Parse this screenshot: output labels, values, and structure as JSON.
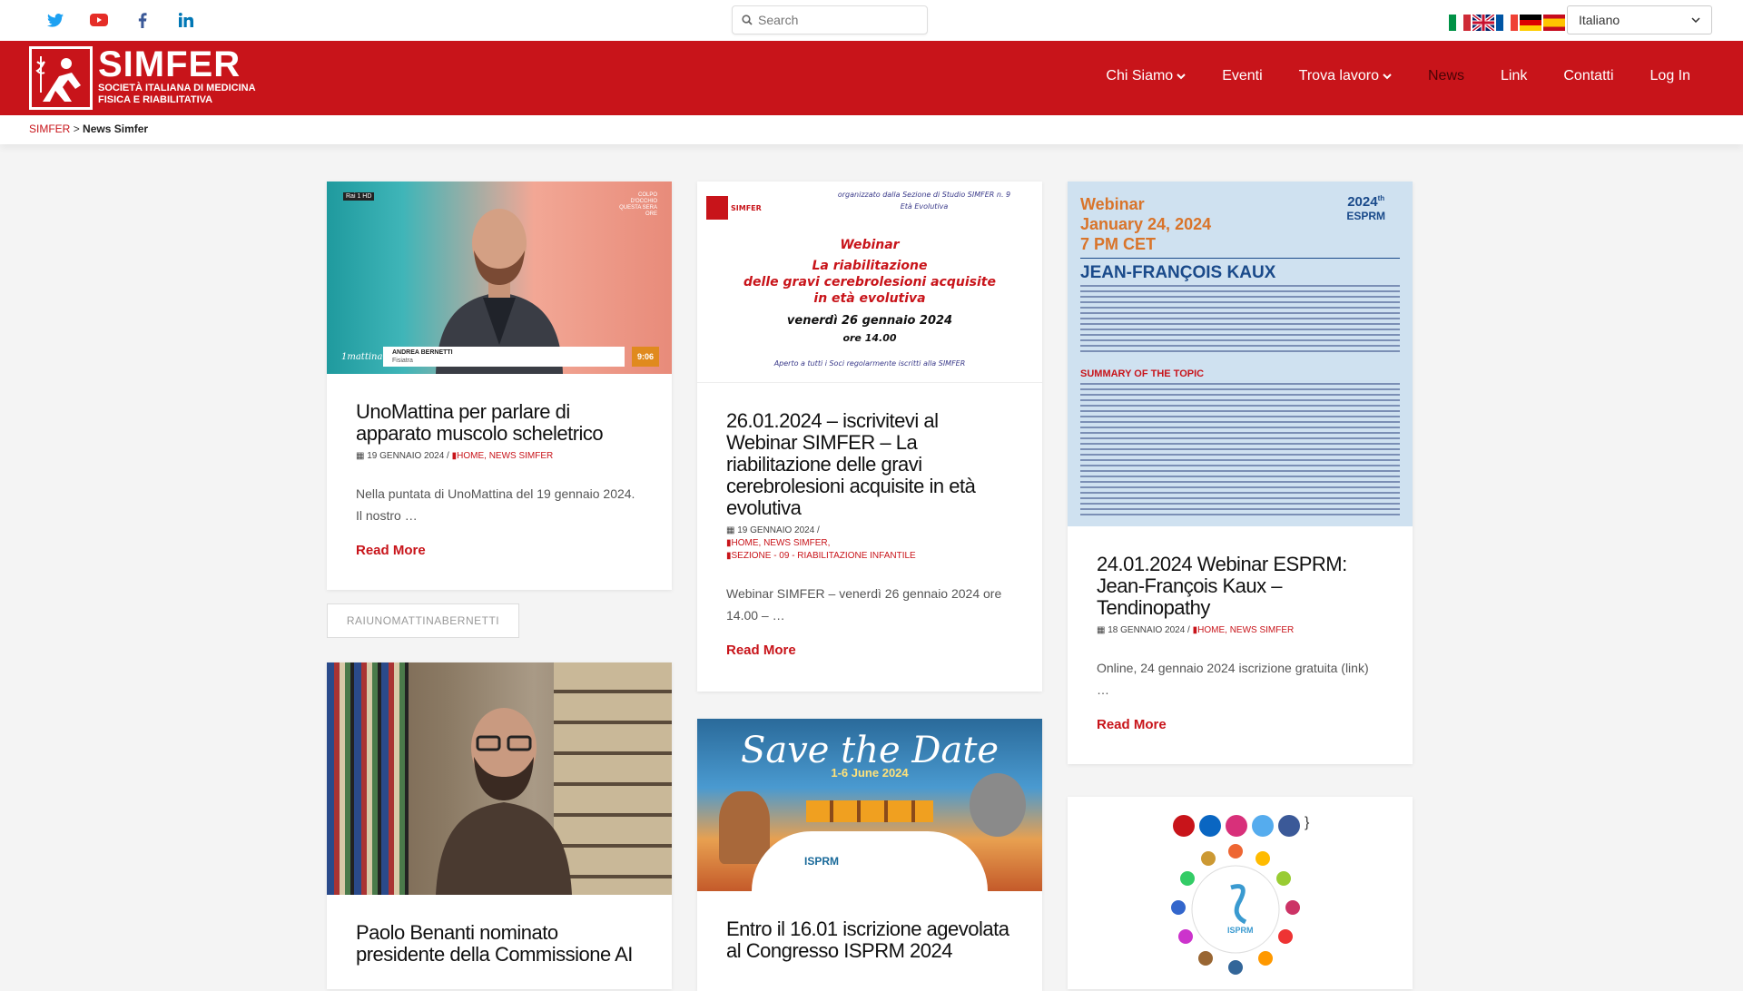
{
  "topbar": {
    "social": [
      {
        "name": "twitter-icon",
        "color": "#1da1f2"
      },
      {
        "name": "youtube-icon",
        "color": "#e52d27"
      },
      {
        "name": "facebook-icon",
        "color": "#3b5998"
      },
      {
        "name": "linkedin-icon",
        "color": "#0077b5"
      }
    ],
    "search_placeholder": "Search",
    "flags": [
      "italian-flag-icon",
      "uk-flag-icon",
      "french-flag-icon",
      "german-flag-icon",
      "spanish-flag-icon"
    ],
    "language": "Italiano"
  },
  "header": {
    "logo_title": "SIMFER",
    "logo_subtitle_1": "SOCIETÀ ITALIANA DI MEDICINA",
    "logo_subtitle_2": "FISICA E RIABILITATIVA",
    "brand_color": "#c8141a",
    "nav": [
      {
        "label": "Chi Siamo",
        "dropdown": true
      },
      {
        "label": "Eventi",
        "dropdown": false
      },
      {
        "label": "Trova lavoro",
        "dropdown": true
      },
      {
        "label": "News",
        "dropdown": false,
        "active": true
      },
      {
        "label": "Link",
        "dropdown": false
      },
      {
        "label": "Contatti",
        "dropdown": false
      },
      {
        "label": "Log In",
        "dropdown": false
      }
    ]
  },
  "breadcrumb": {
    "home": "SIMFER",
    "separator": ">",
    "current": "News Simfer"
  },
  "posts": [
    {
      "title": "UnoMattina per parlare di apparato muscolo scheletrico",
      "date": "19 GENNAIO 2024",
      "categories": "HOME, NEWS SIMFER",
      "excerpt": "Nella puntata di UnoMattina del 19 gennaio 2024. Il nostro …",
      "read_more": "Read More",
      "image": {
        "name_lower": "ANDREA BERNETTI",
        "role": "Fisiatra",
        "time": "9:06",
        "brand": "1mattina",
        "channel": "Rai 1 HD",
        "corner": "COLPO D'OCCHIO QUESTA SERA ORE"
      }
    },
    {
      "title": "26.01.2024 – iscrivitevi al Webinar SIMFER – La riabilitazione delle gravi cerebrolesioni acquisite in età evolutiva",
      "date": "19 GENNAIO 2024",
      "categories_1": "HOME, NEWS SIMFER,",
      "categories_2": "SEZIONE - 09 - RIABILITAZIONE INFANTILE",
      "excerpt": "Webinar SIMFER – venerdì 26 gennaio 2024 ore 14.00 – …",
      "read_more": "Read More",
      "image": {
        "org_1": "organizzato dalla Sezione di Studio SIMFER n. 9",
        "org_2": "Età Evolutiva",
        "logo": "SIMFER",
        "webinar": "Webinar",
        "t1": "La riabilitazione",
        "t2": "delle gravi cerebrolesioni acquisite",
        "t3": "in età evolutiva",
        "date": "venerdì 26 gennaio 2024",
        "time": "ore 14.00",
        "footer": "Aperto a tutti i Soci regolarmente iscritti alla SIMFER"
      }
    },
    {
      "title": "24.01.2024 Webinar ESPRM: Jean-François Kaux – Tendinopathy",
      "date": "18 GENNAIO 2024",
      "categories": "HOME, NEWS SIMFER",
      "excerpt": "Online, 24 gennaio 2024   iscrizione gratuita (link)      …",
      "read_more": "Read More",
      "image": {
        "l1": "Webinar",
        "l2": "January 24, 2024",
        "l3": "7 PM CET",
        "badge_year": "2024",
        "badge_th": "th",
        "badge_org": "ESPRM",
        "speaker": "JEAN-FRANÇOIS KAUX",
        "summary": "SUMMARY OF THE TOPIC"
      }
    },
    {
      "title": "Paolo Benanti nominato presidente della Commissione AI"
    },
    {
      "title": "Entro il 16.01 iscrizione agevolata al Congresso ISPRM 2024",
      "image": {
        "headline": "Save the Date",
        "dates": "1-6 June 2024",
        "org": "ISPRM"
      }
    },
    {
      "image": {
        "org": "ISPRM"
      }
    }
  ],
  "tag": "RAIUNOMATTINABERNETTI"
}
